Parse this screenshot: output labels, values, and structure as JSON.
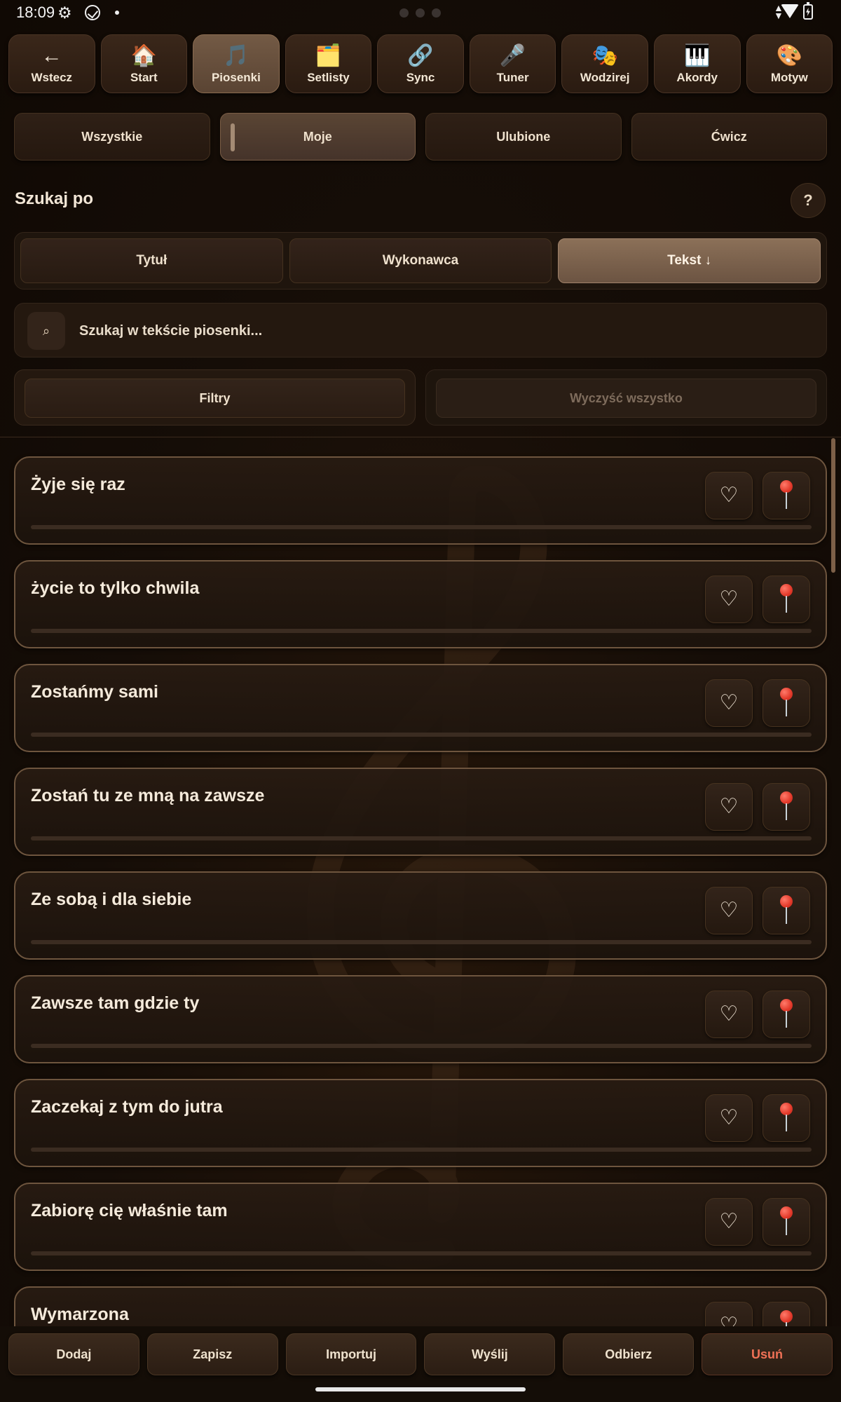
{
  "status_bar": {
    "time": "18:09"
  },
  "topnav": [
    {
      "label": "Wstecz",
      "icon": "←",
      "icon_name": "back-arrow-icon"
    },
    {
      "label": "Start",
      "icon": "🏠",
      "icon_name": "home-icon"
    },
    {
      "label": "Piosenki",
      "icon": "🎵",
      "icon_name": "music-note-icon",
      "active": true
    },
    {
      "label": "Setlisty",
      "icon": "🗂️",
      "icon_name": "folder-icon"
    },
    {
      "label": "Sync",
      "icon": "🔗",
      "icon_name": "link-icon"
    },
    {
      "label": "Tuner",
      "icon": "🎤",
      "icon_name": "microphone-icon"
    },
    {
      "label": "Wodzirej",
      "icon": "🎭",
      "icon_name": "masks-icon"
    },
    {
      "label": "Akordy",
      "icon": "🎹",
      "icon_name": "piano-icon"
    },
    {
      "label": "Motyw",
      "icon": "🎨",
      "icon_name": "palette-icon"
    }
  ],
  "filter_tabs": [
    "Wszystkie",
    "Moje",
    "Ulubione",
    "Ćwicz"
  ],
  "active_filter_tab": "Moje",
  "search": {
    "title": "Szukaj po",
    "help_label": "?",
    "modes": [
      "Tytuł",
      "Wykonawca",
      "Tekst ↓"
    ],
    "active_mode": "Tekst ↓",
    "icon_glyph": "⌕",
    "placeholder": "Szukaj w tekście piosenki...",
    "value": ""
  },
  "actions": {
    "filters": "Filtry",
    "clear_all": "Wyczyść wszystko"
  },
  "songs": [
    {
      "title": "Żyje się raz"
    },
    {
      "title": "życie to tylko chwila"
    },
    {
      "title": "Zostańmy sami"
    },
    {
      "title": "Zostań tu ze mną na zawsze"
    },
    {
      "title": "Ze sobą i dla siebie"
    },
    {
      "title": "Zawsze tam gdzie ty"
    },
    {
      "title": "Zaczekaj z tym do jutra"
    },
    {
      "title": "Zabiorę cię właśnie tam"
    },
    {
      "title": "Wymarzona"
    }
  ],
  "song_icons": {
    "favorite": "♡",
    "pin": "pin-icon"
  },
  "bottom_bar": [
    "Dodaj",
    "Zapisz",
    "Importuj",
    "Wyślij",
    "Odbierz",
    "Usuń"
  ],
  "colors": {
    "accent": "#8b7058",
    "danger": "#f07156",
    "background": "#130c07"
  }
}
